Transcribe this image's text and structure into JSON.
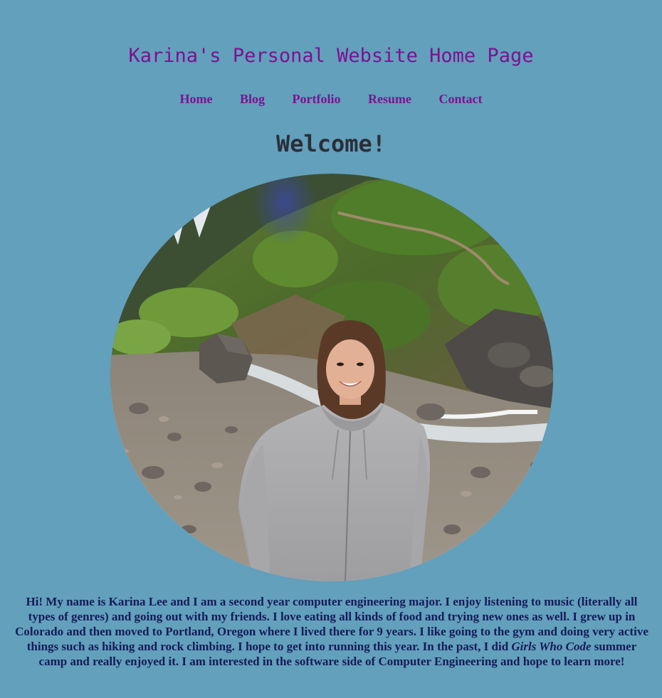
{
  "header": {
    "title": "Karina's Personal Website Home Page"
  },
  "nav": {
    "items": [
      {
        "label": "Home"
      },
      {
        "label": "Blog"
      },
      {
        "label": "Portfolio"
      },
      {
        "label": "Resume"
      },
      {
        "label": "Contact"
      }
    ]
  },
  "main": {
    "heading": "Welcome!",
    "bio": {
      "before": "Hi! My name is Karina Lee and I am a second year computer engineering major. I enjoy listening to music (literally all types of genres) and going out with my friends. I love eating all kinds of food and trying new ones as well. I grew up in Colorado and then moved to Portland, Oregon where I lived there for 9 years. I like going to the gym and doing very active things such as hiking and rock climbing. I hope to get into running this year. In the past, I did ",
      "emphasis": "Girls Who Code",
      "after": " summer camp and really enjoyed it. I am interested in the software side of Computer Engineering and hope to learn more!"
    }
  },
  "colors": {
    "background": "#62a0bc",
    "title": "#7e1192",
    "nav_link": "#7e1192",
    "heading": "#2b2f38",
    "body_text": "#161a58"
  }
}
